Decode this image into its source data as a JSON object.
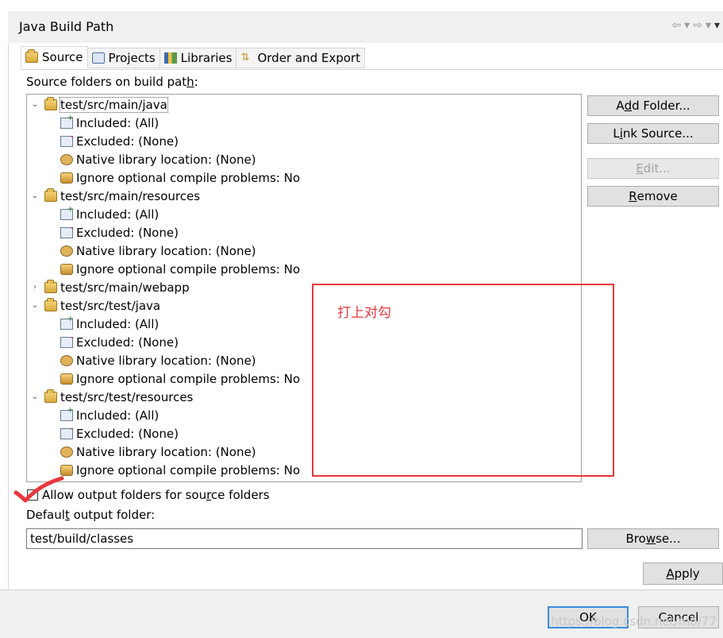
{
  "dialog": {
    "title": "Java Build Path"
  },
  "nav": {
    "back_icon": "back-arrow-icon",
    "forward_icon": "forward-arrow-icon",
    "menu_icon": "view-menu-icon"
  },
  "tabs": [
    {
      "label": "Source",
      "icon": "source-folder-icon"
    },
    {
      "label": "Projects",
      "icon": "projects-icon"
    },
    {
      "label": "Libraries",
      "icon": "libraries-icon"
    },
    {
      "label": "Order and Export",
      "icon": "order-export-icon"
    }
  ],
  "source": {
    "label_pre": "Source folders on build pat",
    "label_mn": "h",
    "label_post": ":",
    "folders": [
      {
        "path": "test/src/main/java",
        "expanded": true,
        "children": [
          "Included: (All)",
          "Excluded: (None)",
          "Native library location: (None)",
          "Ignore optional compile problems: No"
        ]
      },
      {
        "path": "test/src/main/resources",
        "expanded": true,
        "children": [
          "Included: (All)",
          "Excluded: (None)",
          "Native library location: (None)",
          "Ignore optional compile problems: No"
        ]
      },
      {
        "path": "test/src/main/webapp",
        "expanded": false,
        "children": []
      },
      {
        "path": "test/src/test/java",
        "expanded": true,
        "children": [
          "Included: (All)",
          "Excluded: (None)",
          "Native library location: (None)",
          "Ignore optional compile problems: No"
        ]
      },
      {
        "path": "test/src/test/resources",
        "expanded": true,
        "children": [
          "Included: (All)",
          "Excluded: (None)",
          "Native library location: (None)",
          "Ignore optional compile problems: No"
        ]
      }
    ]
  },
  "buttons": {
    "add_folder": {
      "pre": "A",
      "mn": "d",
      "post": "d Folder..."
    },
    "link_source": {
      "pre": "L",
      "mn": "i",
      "post": "nk Source..."
    },
    "edit": {
      "pre": "",
      "mn": "E",
      "post": "dit..."
    },
    "remove": {
      "pre": "",
      "mn": "R",
      "post": "emove"
    },
    "browse": {
      "pre": "Bro",
      "mn": "w",
      "post": "se..."
    },
    "apply": {
      "pre": "",
      "mn": "A",
      "post": "pply"
    },
    "ok": "OK",
    "cancel": "Cancel"
  },
  "allow_output": {
    "pre": "Allow output folders for sou",
    "mn": "r",
    "post": "ce folders",
    "checked": false
  },
  "output_folder": {
    "label_pre": "Defaul",
    "label_mn": "t",
    "label_post": " output folder:",
    "value": "test/build/classes"
  },
  "annotation": {
    "text": "打上对勾",
    "color": "#e8383d"
  },
  "watermark": "https://blog.csdn.net/m0/77"
}
